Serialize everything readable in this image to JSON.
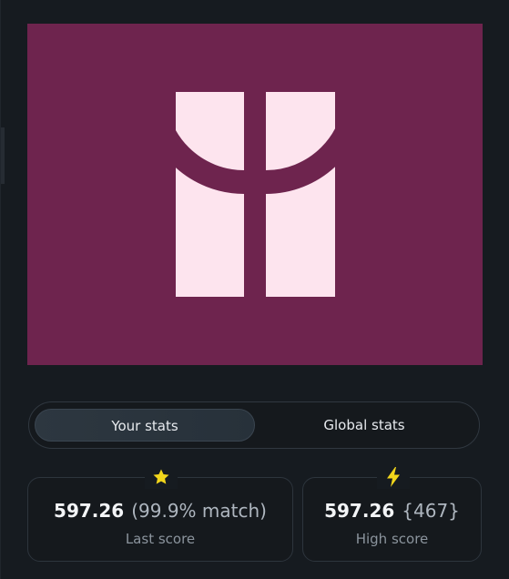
{
  "colors": {
    "artwork_bg": "#6e244e",
    "artwork_shape": "#fde4ee",
    "icon_yellow": "#f2d61b",
    "panel_bg": "#161b20"
  },
  "tabs": {
    "your_stats": "Your stats",
    "global_stats": "Global stats",
    "active": "your_stats"
  },
  "stats": {
    "last": {
      "icon": "star-icon",
      "value": "597.26",
      "extra": "(99.9% match)",
      "label": "Last score"
    },
    "high": {
      "icon": "lightning-icon",
      "value": "597.26",
      "extra": "{467}",
      "label": "High score"
    }
  }
}
